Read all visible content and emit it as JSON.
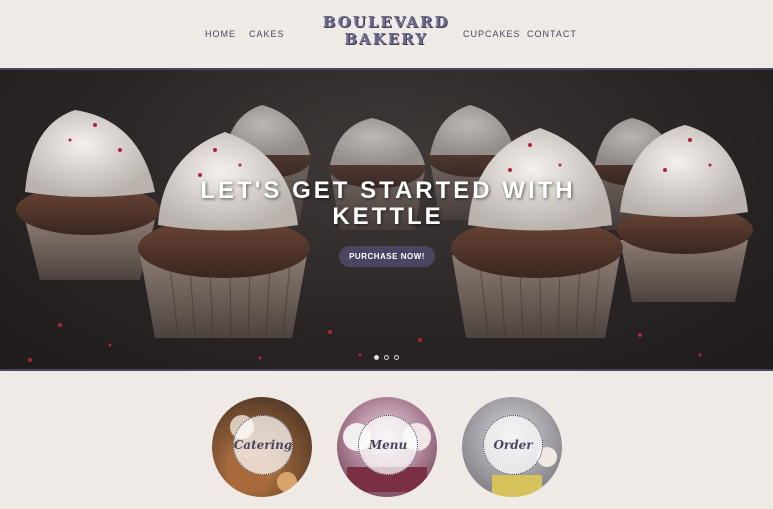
{
  "header": {
    "nav_left": [
      "HOME",
      "CAKES"
    ],
    "logo_line1": "BOULEVARD",
    "logo_line2": "BAKERY",
    "nav_right": [
      "CUPCAKES",
      "CONTACT"
    ]
  },
  "hero": {
    "title_line1": "LET'S GET STARTED WITH",
    "title_line2": "KETTLE",
    "cta_label": "PURCHASE NOW!",
    "slides_total": 3,
    "active_slide": 1
  },
  "features": [
    {
      "label": "Catering",
      "icon": "catering-photo"
    },
    {
      "label": "Menu",
      "icon": "menu-photo"
    },
    {
      "label": "Order",
      "icon": "order-photo"
    }
  ],
  "colors": {
    "accent": "#4a4560",
    "background": "#efeae6",
    "logo": "#6f6a8e"
  }
}
